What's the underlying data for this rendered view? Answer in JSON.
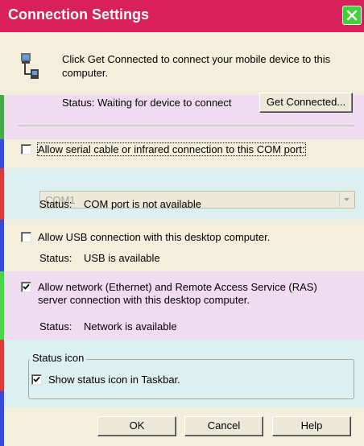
{
  "title": "Connection Settings",
  "intro_text_line1": "Click Get Connected to connect your mobile device to this",
  "intro_text_line2": "computer.",
  "status_waiting": "Status: Waiting for device to connect",
  "get_connected_label": "Get Connected...",
  "serial_checkbox_label": "Allow serial cable or infrared connection to this COM port:",
  "serial_checked": false,
  "com_port_selected": "COM1",
  "com_status_label": "Status:",
  "com_status_value": "COM port is not available",
  "usb_checkbox_label": "Allow USB connection with this desktop computer.",
  "usb_checked": false,
  "usb_status_label": "Status:",
  "usb_status_value": "USB is available",
  "network_checkbox_line1": "Allow network (Ethernet) and Remote Access Service (RAS)",
  "network_checkbox_line2": "server connection with this desktop computer.",
  "network_checked": true,
  "network_status_label": "Status:",
  "network_status_value": "Network is available",
  "status_icon_group": "Status icon",
  "taskbar_checkbox_label": "Show status icon in Taskbar.",
  "taskbar_checked": true,
  "ok_label": "OK",
  "cancel_label": "Cancel",
  "help_label": "Help",
  "colors": {
    "titlebar": "#d8205a",
    "close_button": "#41d23a",
    "band_beige": "#f4eedc",
    "band_lilac": "#f0dcf0",
    "band_cyan": "#dcf0f0"
  },
  "icons": {
    "close": "close-icon",
    "device": "device-connection-icon",
    "dropdown": "chevron-down-icon",
    "check": "checkmark-icon"
  }
}
